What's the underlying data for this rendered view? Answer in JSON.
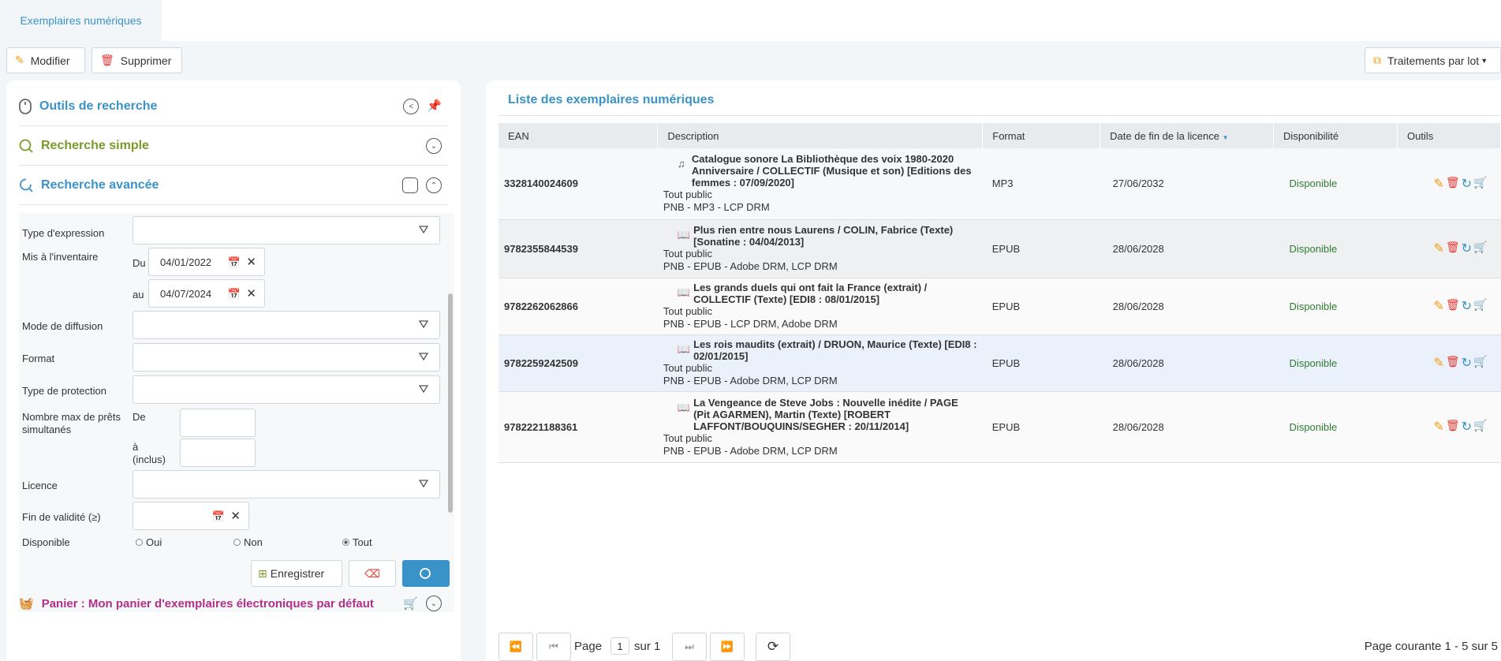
{
  "tabs": {
    "active": "Exemplaires numériques"
  },
  "toolbar": {
    "edit_label": "Modifier",
    "delete_label": "Supprimer",
    "batch_label": "Traitements par lot"
  },
  "left": {
    "tools_title": "Outils de recherche",
    "simple_title": "Recherche simple",
    "advanced_title": "Recherche avancée",
    "labels": {
      "expression": "Type d'expression",
      "inventory": "Mis à l'inventaire",
      "from": "Du",
      "to": "au",
      "diffusion": "Mode de diffusion",
      "format": "Format",
      "protection": "Type de protection",
      "max_loans": "Nombre max de prêts simultanés",
      "max_from": "De",
      "max_to": "à (inclus)",
      "licence": "Licence",
      "validity": "Fin de validité (≥)",
      "available": "Disponible"
    },
    "inventory_from": "04/01/2022",
    "inventory_to": "04/07/2024",
    "radio": {
      "yes": "Oui",
      "no": "Non",
      "all": "Tout"
    },
    "save_label": "Enregistrer",
    "basket_title": "Panier : Mon panier d'exemplaires électroniques par défaut"
  },
  "list": {
    "title": "Liste des exemplaires numériques",
    "columns": [
      "EAN",
      "Description",
      "Format",
      "Date de fin de la licence",
      "Disponibilité",
      "Outils"
    ],
    "rows": [
      {
        "ean": "3328140024609",
        "icon": "music-icon",
        "title": "Catalogue sonore La Bibliothèque des voix 1980-2020 Anniversaire / COLLECTIF (Musique et son) [Editions des femmes : 07/09/2020]",
        "audience": "Tout public",
        "drm": "PNB - MP3 - LCP DRM",
        "format": "MP3",
        "end_date": "27/06/2032",
        "availability": "Disponible"
      },
      {
        "ean": "9782355844539",
        "icon": "book-icon",
        "title": "Plus rien entre nous Laurens / COLIN, Fabrice (Texte) [Sonatine : 04/04/2013]",
        "audience": "Tout public",
        "drm": "PNB - EPUB - Adobe DRM, LCP DRM",
        "format": "EPUB",
        "end_date": "28/06/2028",
        "availability": "Disponible"
      },
      {
        "ean": "9782262062866",
        "icon": "book-icon",
        "title": "Les grands duels qui ont fait la France (extrait) / COLLECTIF (Texte) [EDI8 : 08/01/2015]",
        "audience": "Tout public",
        "drm": "PNB - EPUB - LCP DRM, Adobe DRM",
        "format": "EPUB",
        "end_date": "28/06/2028",
        "availability": "Disponible"
      },
      {
        "ean": "9782259242509",
        "icon": "book-icon",
        "title": "Les rois maudits (extrait) / DRUON, Maurice (Texte) [EDI8 : 02/01/2015]",
        "audience": "Tout public",
        "drm": "PNB - EPUB - Adobe DRM, LCP DRM",
        "format": "EPUB",
        "end_date": "28/06/2028",
        "availability": "Disponible"
      },
      {
        "ean": "9782221188361",
        "icon": "book-icon",
        "title": "La Vengeance de Steve Jobs : Nouvelle inédite / PAGE (Pit AGARMEN), Martin (Texte) [ROBERT LAFFONT/BOUQUINS/SEGHER : 20/11/2014]",
        "audience": "Tout public",
        "drm": "PNB - EPUB - Adobe DRM, LCP DRM",
        "format": "EPUB",
        "end_date": "28/06/2028",
        "availability": "Disponible"
      }
    ]
  },
  "pager": {
    "page_label": "Page",
    "page_value": "1",
    "of_label": "sur 1",
    "status": "Page courante 1 - 5 sur 5"
  },
  "colors": {
    "accent": "#3a93c8",
    "simple": "#7a9a2a",
    "basket": "#b0308a",
    "available": "#2e7d32",
    "tools_orange": "#f39c12",
    "tools_red": "#e53935"
  }
}
